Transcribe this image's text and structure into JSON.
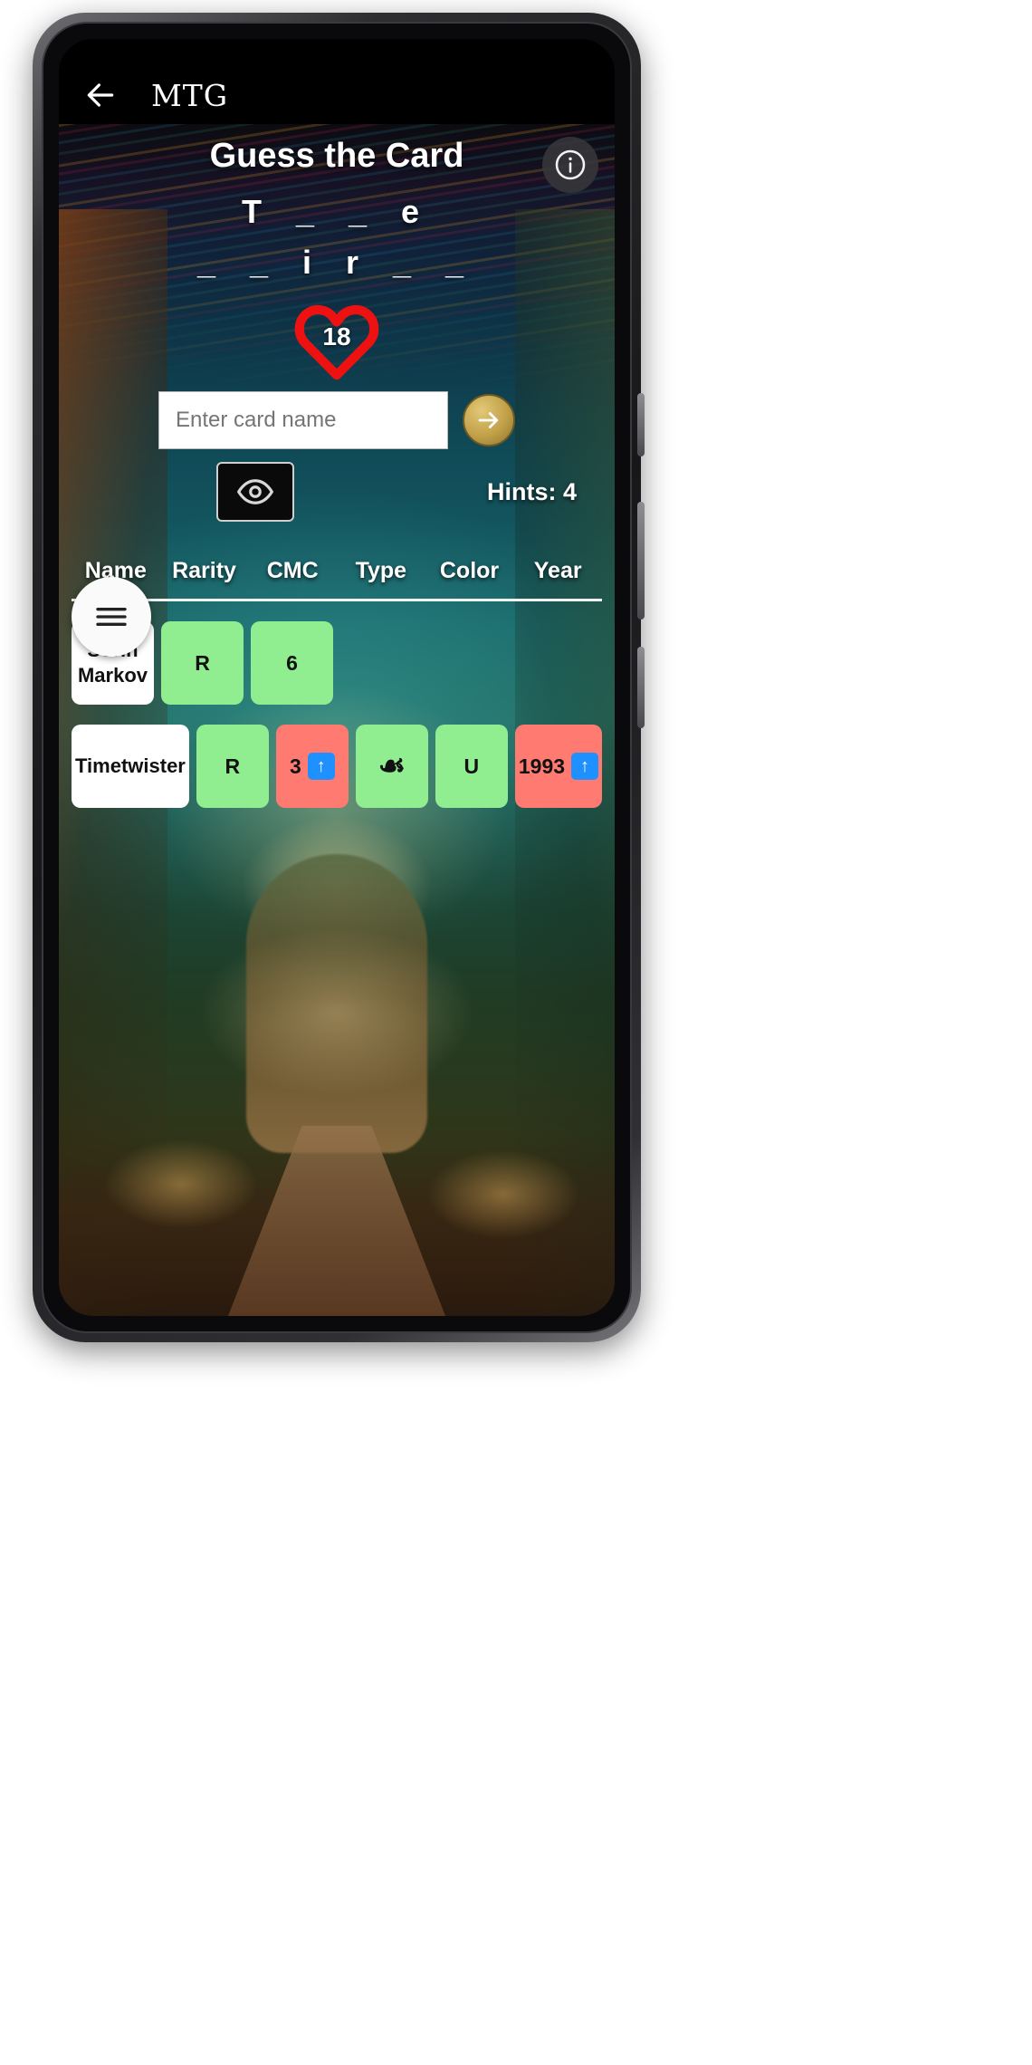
{
  "appbar": {
    "back_icon": "back-arrow-icon",
    "brand": "MTG"
  },
  "game": {
    "title": "Guess the Card",
    "info_icon": "info-icon",
    "puzzle_line1": "T _ _ e",
    "puzzle_line2": "_ _ i r _ _",
    "lives_count": "18",
    "heart_icon": "heart-icon",
    "heart_color": "#ee1111",
    "input_placeholder": "Enter card name",
    "input_value": "",
    "submit_icon": "arrow-right-icon",
    "reveal_icon": "eye-icon",
    "hints_label": "Hints: 4",
    "menu_icon": "hamburger-menu-icon"
  },
  "table": {
    "headers": [
      "Name",
      "Rarity",
      "CMC",
      "Type",
      "Color",
      "Year"
    ],
    "rows": [
      {
        "cells": [
          {
            "text": "Sorin Markov",
            "state": "name"
          },
          {
            "text": "R",
            "state": "green"
          },
          {
            "text": "6",
            "state": "green"
          },
          {
            "text": "",
            "state": "empty"
          },
          {
            "text": "",
            "state": "empty"
          },
          {
            "text": "",
            "state": "empty"
          }
        ]
      },
      {
        "cells": [
          {
            "text": "Timetwister",
            "state": "name"
          },
          {
            "text": "R",
            "state": "green"
          },
          {
            "text": "3",
            "state": "red",
            "hint": "up"
          },
          {
            "text": "☙",
            "state": "green",
            "symbol": true
          },
          {
            "text": "U",
            "state": "green"
          },
          {
            "text": "1993",
            "state": "red",
            "hint": "up"
          }
        ]
      }
    ]
  },
  "colors": {
    "correct": "#90ee90",
    "wrong": "#ff7b72",
    "neutral": "#ffffff",
    "hint_badge": "#1e90ff"
  }
}
